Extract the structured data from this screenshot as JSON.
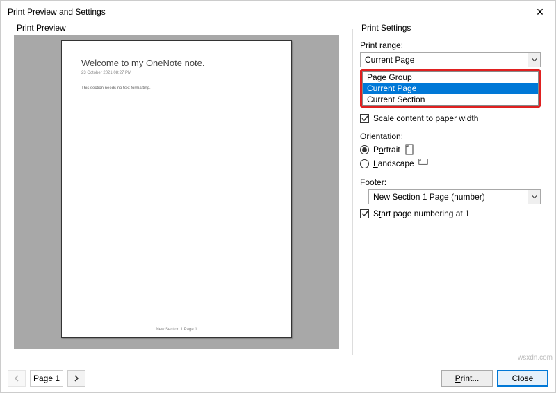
{
  "dialog": {
    "title": "Print Preview and Settings"
  },
  "preview": {
    "group_label": "Print Preview",
    "page_title": "Welcome to my OneNote note.",
    "page_meta": "23 October 2021     08:27 PM",
    "page_body": "This section needs no text formatting.",
    "page_footer": "New Section 1  Page 1"
  },
  "settings": {
    "group_label": "Print Settings",
    "print_range": {
      "label": "Print range:",
      "selected": "Current Page",
      "options": [
        "Page Group",
        "Current Page",
        "Current Section"
      ],
      "highlighted_index": 1
    },
    "scale_label": "Scale content to paper width",
    "scale_checked": true,
    "orientation": {
      "label": "Orientation:",
      "portrait_label": "Portrait",
      "landscape_label": "Landscape",
      "selected": "portrait"
    },
    "footer": {
      "label": "Footer:",
      "value": "New Section 1 Page (number)"
    },
    "start_numbering_label": "Start page numbering at 1",
    "start_numbering_checked": true
  },
  "bottom": {
    "page_indicator": "Page 1",
    "print_label": "Print...",
    "close_label": "Close"
  },
  "watermark": "wsxdn.com"
}
